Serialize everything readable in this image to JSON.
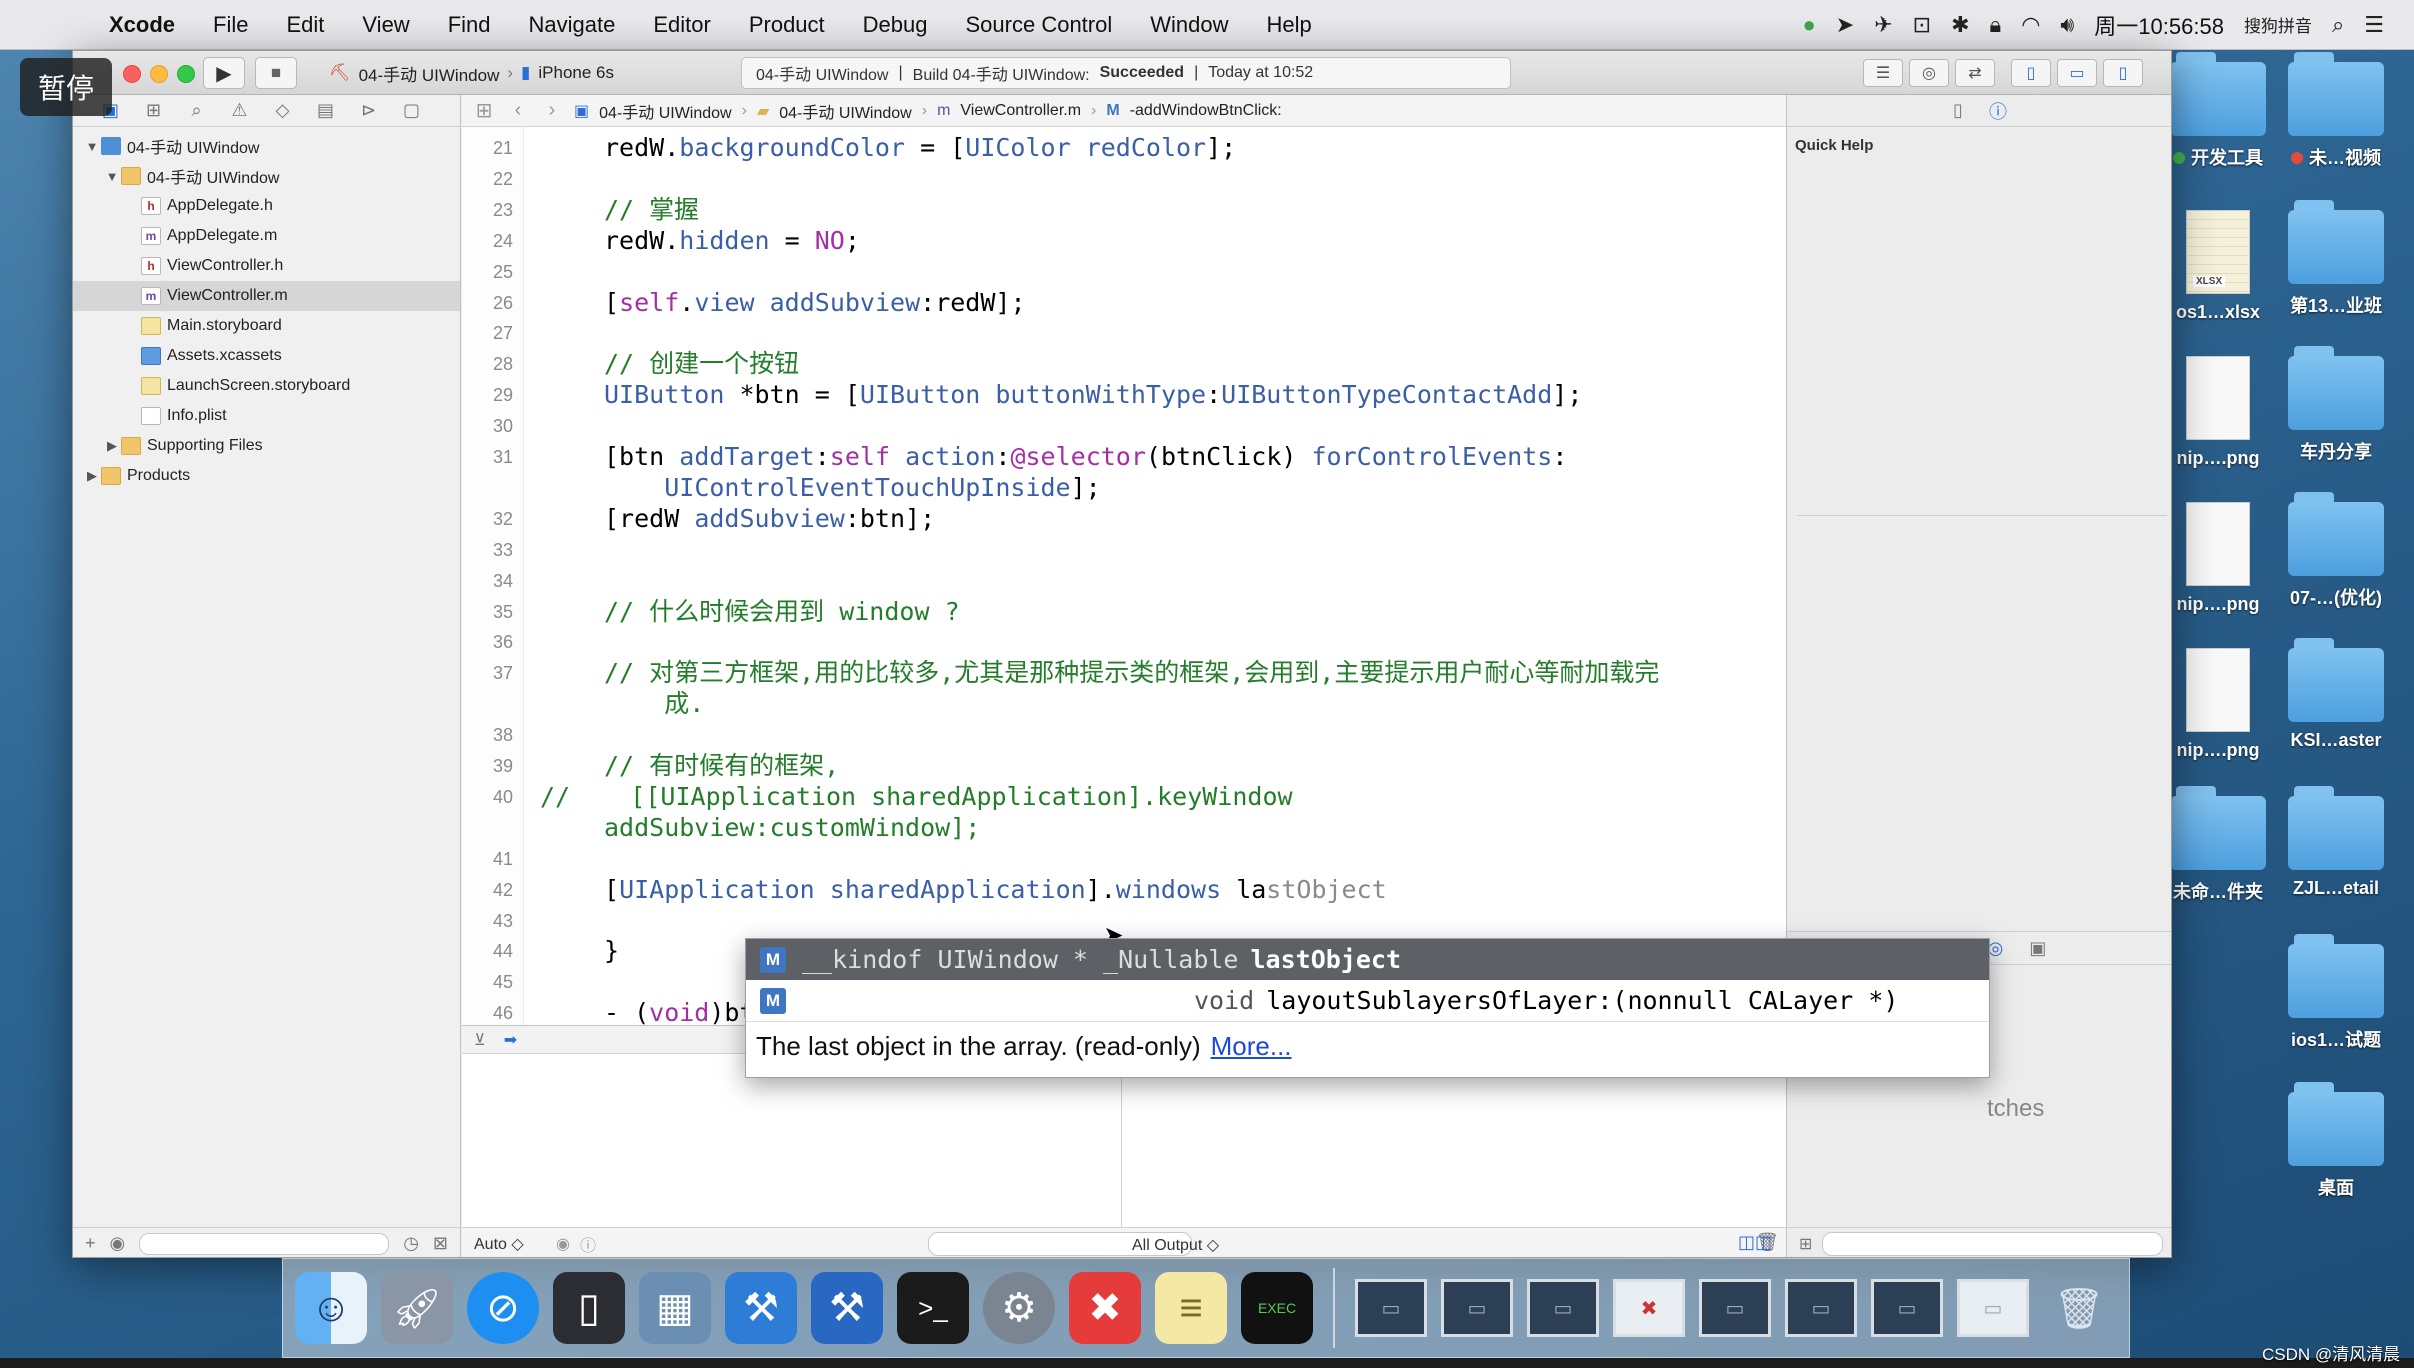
{
  "menubar": {
    "apple_glyph": "",
    "items": [
      "Xcode",
      "File",
      "Edit",
      "View",
      "Find",
      "Navigate",
      "Editor",
      "Product",
      "Debug",
      "Source Control",
      "Window",
      "Help"
    ],
    "clock": "周一10:56:58",
    "input_method": "搜狗拼音"
  },
  "pause_badge": "暂停",
  "toolbar": {
    "scheme": "04-手动 UIWindow",
    "device": "iPhone 6s",
    "activity": {
      "project": "04-手动 UIWindow",
      "build_prefix": "Build 04-手动 UIWindow:",
      "build_status": "Succeeded",
      "time": "Today at 10:52"
    }
  },
  "navigator": {
    "tree": [
      {
        "label": "04-手动 UIWindow",
        "icon": "project",
        "level": 0,
        "disclosure": "▼"
      },
      {
        "label": "04-手动 UIWindow",
        "icon": "folder",
        "level": 1,
        "disclosure": "▼"
      },
      {
        "label": "AppDelegate.h",
        "icon": "h",
        "level": 2
      },
      {
        "label": "AppDelegate.m",
        "icon": "m",
        "level": 2
      },
      {
        "label": "ViewController.h",
        "icon": "h",
        "level": 2
      },
      {
        "label": "ViewController.m",
        "icon": "m",
        "level": 2,
        "selected": true
      },
      {
        "label": "Main.storyboard",
        "icon": "sb",
        "level": 2
      },
      {
        "label": "Assets.xcassets",
        "icon": "assets",
        "level": 2
      },
      {
        "label": "LaunchScreen.storyboard",
        "icon": "sb",
        "level": 2
      },
      {
        "label": "Info.plist",
        "icon": "plist",
        "level": 2
      },
      {
        "label": "Supporting Files",
        "icon": "folder",
        "level": 1,
        "disclosure": "▶"
      },
      {
        "label": "Products",
        "icon": "folder",
        "level": 0,
        "disclosure": "▶"
      }
    ]
  },
  "jumpbar": {
    "crumbs": [
      "04-手动 UIWindow",
      "04-手动 UIWindow",
      "ViewController.m",
      "-addWindowBtnClick:"
    ]
  },
  "editor": {
    "lines": [
      {
        "no": "21",
        "html": "<span>redW.</span><span class='prop'>backgroundColor</span><span> = [</span><span class='cls'>UIColor</span><span> </span><span class='sel'>redColor</span><span>];</span>"
      },
      {
        "no": "22",
        "html": ""
      },
      {
        "no": "23",
        "html": "<span class='cm'>// 掌握</span>"
      },
      {
        "no": "24",
        "html": "<span>redW.</span><span class='prop'>hidden</span><span> = </span><span class='kw'>NO</span><span>;</span>"
      },
      {
        "no": "25",
        "html": ""
      },
      {
        "no": "26",
        "html": "<span>[</span><span class='kw'>self</span><span>.</span><span class='prop'>view</span><span> </span><span class='sel'>addSubview</span><span>:redW];</span>"
      },
      {
        "no": "27",
        "html": ""
      },
      {
        "no": "28",
        "html": "<span class='cm'>// 创建一个按钮</span>"
      },
      {
        "no": "29",
        "html": "<span class='cls'>UIButton</span><span> *btn = [</span><span class='cls'>UIButton</span><span> </span><span class='sel'>buttonWithType</span><span>:</span><span class='cls'>UIButtonTypeContactAdd</span><span>];</span>"
      },
      {
        "no": "30",
        "html": ""
      },
      {
        "no": "31",
        "html": "<span>[btn </span><span class='sel'>addTarget</span><span>:</span><span class='kw'>self</span><span> </span><span class='sel'>action</span><span>:</span><span class='kw'>@selector</span><span>(btnClick) </span><span class='sel'>forControlEvents</span><span>:</span>"
      },
      {
        "no": "",
        "html": "<span>    </span><span class='cls'>UIControlEventTouchUpInside</span><span>];</span>"
      },
      {
        "no": "32",
        "html": "<span>[redW </span><span class='sel'>addSubview</span><span>:btn];</span>"
      },
      {
        "no": "33",
        "html": ""
      },
      {
        "no": "34",
        "html": ""
      },
      {
        "no": "35",
        "html": "<span class='cm'>// 什么时候会用到 window ?</span>"
      },
      {
        "no": "36",
        "html": ""
      },
      {
        "no": "37",
        "html": "<span class='cm'>// 对第三方框架,用的比较多,尤其是那种提示类的框架,会用到,主要提示用户耐心等耐加载完</span>"
      },
      {
        "no": "",
        "html": "<span class='cm'>    成.</span>"
      },
      {
        "no": "38",
        "html": ""
      },
      {
        "no": "39",
        "html": "<span class='cm'>// 有时候有的框架,</span>"
      },
      {
        "no": "40",
        "html": "<span class='cm'>//    [[UIApplication sharedApplication].keyWindow</span>"
      },
      {
        "no": "",
        "html": "<span class='cm'>addSubview:customWindow];</span>"
      },
      {
        "no": "41",
        "html": ""
      },
      {
        "no": "42",
        "html": "<span>[</span><span class='cls'>UIApplication</span><span> </span><span class='sel'>sharedApplication</span><span>].</span><span class='prop'>windows</span><span> la</span><span class='ghost'>stObject</span>"
      },
      {
        "no": "43",
        "html": ""
      },
      {
        "no": "44",
        "html": "<span>}</span>"
      },
      {
        "no": "45",
        "html": ""
      },
      {
        "no": "46",
        "html": "<span>- (</span><span class='kw'>void</span><span>)btnCl</span>"
      }
    ]
  },
  "autocomplete": {
    "items": [
      {
        "badge": "M",
        "type": "__kindof UIWindow * _Nullable",
        "name": "lastObject"
      },
      {
        "badge": "M",
        "type": "void",
        "name": "layoutSublayersOfLayer:(nonnull CALayer *)"
      }
    ],
    "description": "The last object in the array. (read-only)",
    "more_link": "More..."
  },
  "debug": {
    "variables_filter": "Auto ◇",
    "output_filter": "All Output ◇"
  },
  "utilities": {
    "quick_help_title": "Quick Help",
    "library_partial_text": "tches"
  },
  "desktop_icons": [
    {
      "label": "开发工具",
      "type": "folder",
      "dot": "green"
    },
    {
      "label": "未…视频",
      "type": "folder",
      "dot": "red"
    },
    {
      "label": "os1…xlsx",
      "type": "xlsx",
      "tag": "XLSX"
    },
    {
      "label": "第13…业班",
      "type": "folder"
    },
    {
      "label": "nip….png",
      "type": "png"
    },
    {
      "label": "车丹分享",
      "type": "folder"
    },
    {
      "label": "nip….png",
      "type": "png"
    },
    {
      "label": "07-…(优化)",
      "type": "folder"
    },
    {
      "label": "nip….png",
      "type": "png"
    },
    {
      "label": "KSI…aster",
      "type": "folder"
    },
    {
      "label": "未命…件夹",
      "type": "folder"
    },
    {
      "label": "ZJL…etail",
      "type": "folder"
    },
    {
      "label": "ios1…试题",
      "type": "folder"
    },
    {
      "label": "桌面",
      "type": "folder"
    }
  ],
  "watermark": "CSDN @清风清晨"
}
